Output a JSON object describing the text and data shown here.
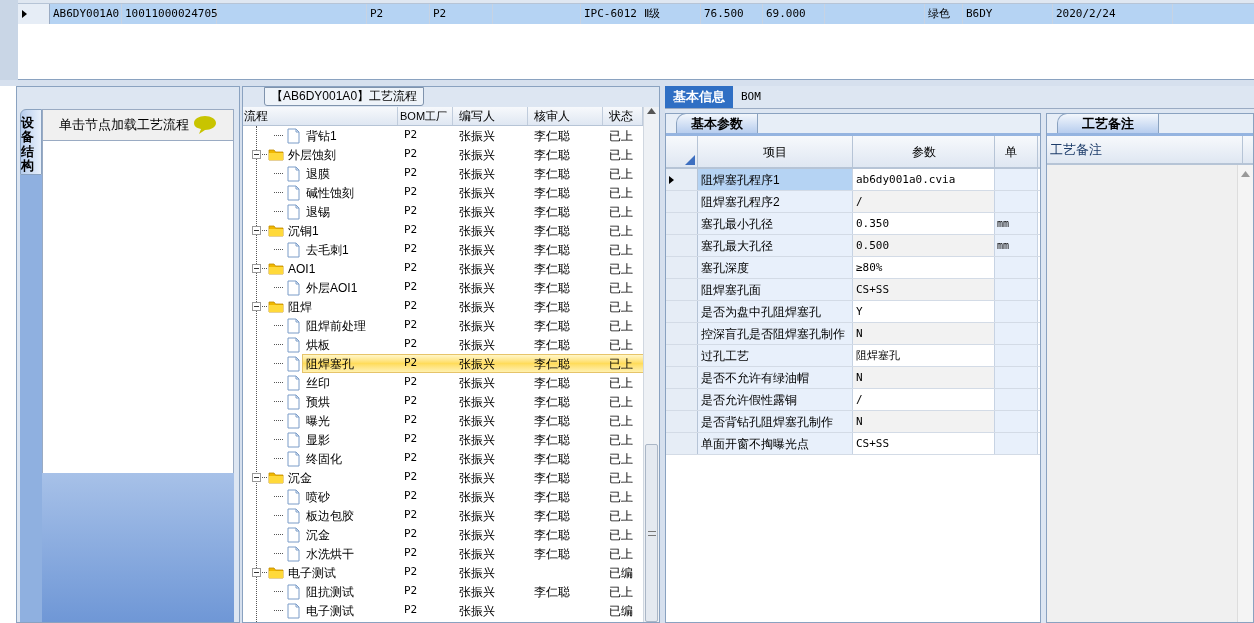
{
  "top_grid": {
    "rows": [
      {
        "selected": true,
        "cells": [
          "AB6DY001A0",
          "10011000024705",
          "",
          "P2",
          "P2",
          "",
          "IPC-6012 Ⅱ级",
          "76.500",
          "69.000",
          "",
          "绿色",
          "B6DY",
          "2020/2/24"
        ]
      }
    ]
  },
  "left_panel": {
    "side_tab": "设备结构",
    "hint": "单击节点加载工艺流程"
  },
  "flow": {
    "title": "【AB6DY001A0】工艺流程",
    "columns": [
      "流程",
      "BOM工厂",
      "编写人",
      "核审人",
      "状态"
    ],
    "tree": [
      {
        "kind": "file",
        "label": "背钻1",
        "bom": "P2",
        "writer": "张振兴",
        "reviewer": "李仁聪",
        "status": "已上",
        "selected": false
      },
      {
        "kind": "folder",
        "label": "外层蚀刻",
        "bom": "P2",
        "writer": "张振兴",
        "reviewer": "李仁聪",
        "status": "已上",
        "selected": false,
        "children": [
          {
            "kind": "file",
            "label": "退膜",
            "bom": "P2",
            "writer": "张振兴",
            "reviewer": "李仁聪",
            "status": "已上",
            "selected": false
          },
          {
            "kind": "file",
            "label": "碱性蚀刻",
            "bom": "P2",
            "writer": "张振兴",
            "reviewer": "李仁聪",
            "status": "已上",
            "selected": false
          },
          {
            "kind": "file",
            "label": "退锡",
            "bom": "P2",
            "writer": "张振兴",
            "reviewer": "李仁聪",
            "status": "已上",
            "selected": false
          }
        ]
      },
      {
        "kind": "folder",
        "label": "沉铜1",
        "bom": "P2",
        "writer": "张振兴",
        "reviewer": "李仁聪",
        "status": "已上",
        "selected": false,
        "children": [
          {
            "kind": "file",
            "label": "去毛刺1",
            "bom": "P2",
            "writer": "张振兴",
            "reviewer": "李仁聪",
            "status": "已上",
            "selected": false
          }
        ]
      },
      {
        "kind": "folder",
        "label": "AOI1",
        "bom": "P2",
        "writer": "张振兴",
        "reviewer": "李仁聪",
        "status": "已上",
        "selected": false,
        "children": [
          {
            "kind": "file",
            "label": "外层AOI1",
            "bom": "P2",
            "writer": "张振兴",
            "reviewer": "李仁聪",
            "status": "已上",
            "selected": false
          }
        ]
      },
      {
        "kind": "folder",
        "label": "阻焊",
        "bom": "P2",
        "writer": "张振兴",
        "reviewer": "李仁聪",
        "status": "已上",
        "selected": false,
        "children": [
          {
            "kind": "file",
            "label": "阻焊前处理",
            "bom": "P2",
            "writer": "张振兴",
            "reviewer": "李仁聪",
            "status": "已上",
            "selected": false
          },
          {
            "kind": "file",
            "label": "烘板",
            "bom": "P2",
            "writer": "张振兴",
            "reviewer": "李仁聪",
            "status": "已上",
            "selected": false
          },
          {
            "kind": "file",
            "label": "阻焊塞孔",
            "bom": "P2",
            "writer": "张振兴",
            "reviewer": "李仁聪",
            "status": "已上",
            "selected": true
          },
          {
            "kind": "file",
            "label": "丝印",
            "bom": "P2",
            "writer": "张振兴",
            "reviewer": "李仁聪",
            "status": "已上",
            "selected": false
          },
          {
            "kind": "file",
            "label": "预烘",
            "bom": "P2",
            "writer": "张振兴",
            "reviewer": "李仁聪",
            "status": "已上",
            "selected": false
          },
          {
            "kind": "file",
            "label": "曝光",
            "bom": "P2",
            "writer": "张振兴",
            "reviewer": "李仁聪",
            "status": "已上",
            "selected": false
          },
          {
            "kind": "file",
            "label": "显影",
            "bom": "P2",
            "writer": "张振兴",
            "reviewer": "李仁聪",
            "status": "已上",
            "selected": false
          },
          {
            "kind": "file",
            "label": "终固化",
            "bom": "P2",
            "writer": "张振兴",
            "reviewer": "李仁聪",
            "status": "已上",
            "selected": false
          }
        ]
      },
      {
        "kind": "folder",
        "label": "沉金",
        "bom": "P2",
        "writer": "张振兴",
        "reviewer": "李仁聪",
        "status": "已上",
        "selected": false,
        "children": [
          {
            "kind": "file",
            "label": "喷砂",
            "bom": "P2",
            "writer": "张振兴",
            "reviewer": "李仁聪",
            "status": "已上",
            "selected": false
          },
          {
            "kind": "file",
            "label": "板边包胶",
            "bom": "P2",
            "writer": "张振兴",
            "reviewer": "李仁聪",
            "status": "已上",
            "selected": false
          },
          {
            "kind": "file",
            "label": "沉金",
            "bom": "P2",
            "writer": "张振兴",
            "reviewer": "李仁聪",
            "status": "已上",
            "selected": false
          },
          {
            "kind": "file",
            "label": "水洗烘干",
            "bom": "P2",
            "writer": "张振兴",
            "reviewer": "李仁聪",
            "status": "已上",
            "selected": false
          }
        ]
      },
      {
        "kind": "folder",
        "label": "电子测试",
        "bom": "P2",
        "writer": "张振兴",
        "status": "已编",
        "selected": false,
        "children": [
          {
            "kind": "file",
            "label": "阻抗测试",
            "bom": "P2",
            "writer": "张振兴",
            "reviewer": "李仁聪",
            "status": "已上",
            "selected": false
          },
          {
            "kind": "file",
            "label": "电子测试",
            "bom": "P2",
            "writer": "张振兴",
            "status": "已编",
            "selected": false
          }
        ]
      }
    ]
  },
  "detail_tabs": [
    {
      "label": "基本信息",
      "selected": true
    },
    {
      "label": "BOM",
      "selected": false
    }
  ],
  "params": {
    "tab": "基本参数",
    "columns": [
      "项目",
      "参数",
      "单"
    ],
    "rows": [
      {
        "item": "阻焊塞孔程序1",
        "value": "ab6dy001a0.cvia",
        "selected": true
      },
      {
        "item": "阻焊塞孔程序2",
        "value": "/",
        "selected": false
      },
      {
        "item": "塞孔最小孔径",
        "value": "0.350",
        "unit": "mm",
        "selected": false
      },
      {
        "item": "塞孔最大孔径",
        "value": "0.500",
        "unit": "mm",
        "selected": false
      },
      {
        "item": "塞孔深度",
        "value": "≥80%",
        "selected": false
      },
      {
        "item": "阻焊塞孔面",
        "value": "CS+SS",
        "selected": false
      },
      {
        "item": "是否为盘中孔阻焊塞孔",
        "value": "Y",
        "selected": false
      },
      {
        "item": "控深盲孔是否阻焊塞孔制作",
        "value": "N",
        "selected": false
      },
      {
        "item": "过孔工艺",
        "value": "阻焊塞孔",
        "selected": false
      },
      {
        "item": "是否不允许有绿油帽",
        "value": "N",
        "selected": false
      },
      {
        "item": "是否允许假性露铜",
        "value": "/",
        "selected": false
      },
      {
        "item": "是否背钻孔阻焊塞孔制作",
        "value": "N",
        "selected": false
      },
      {
        "item": "单面开窗不掏曝光点",
        "value": "CS+SS",
        "selected": false
      }
    ]
  },
  "notes": {
    "tab": "工艺备注",
    "columns": [
      "工艺备注"
    ]
  }
}
